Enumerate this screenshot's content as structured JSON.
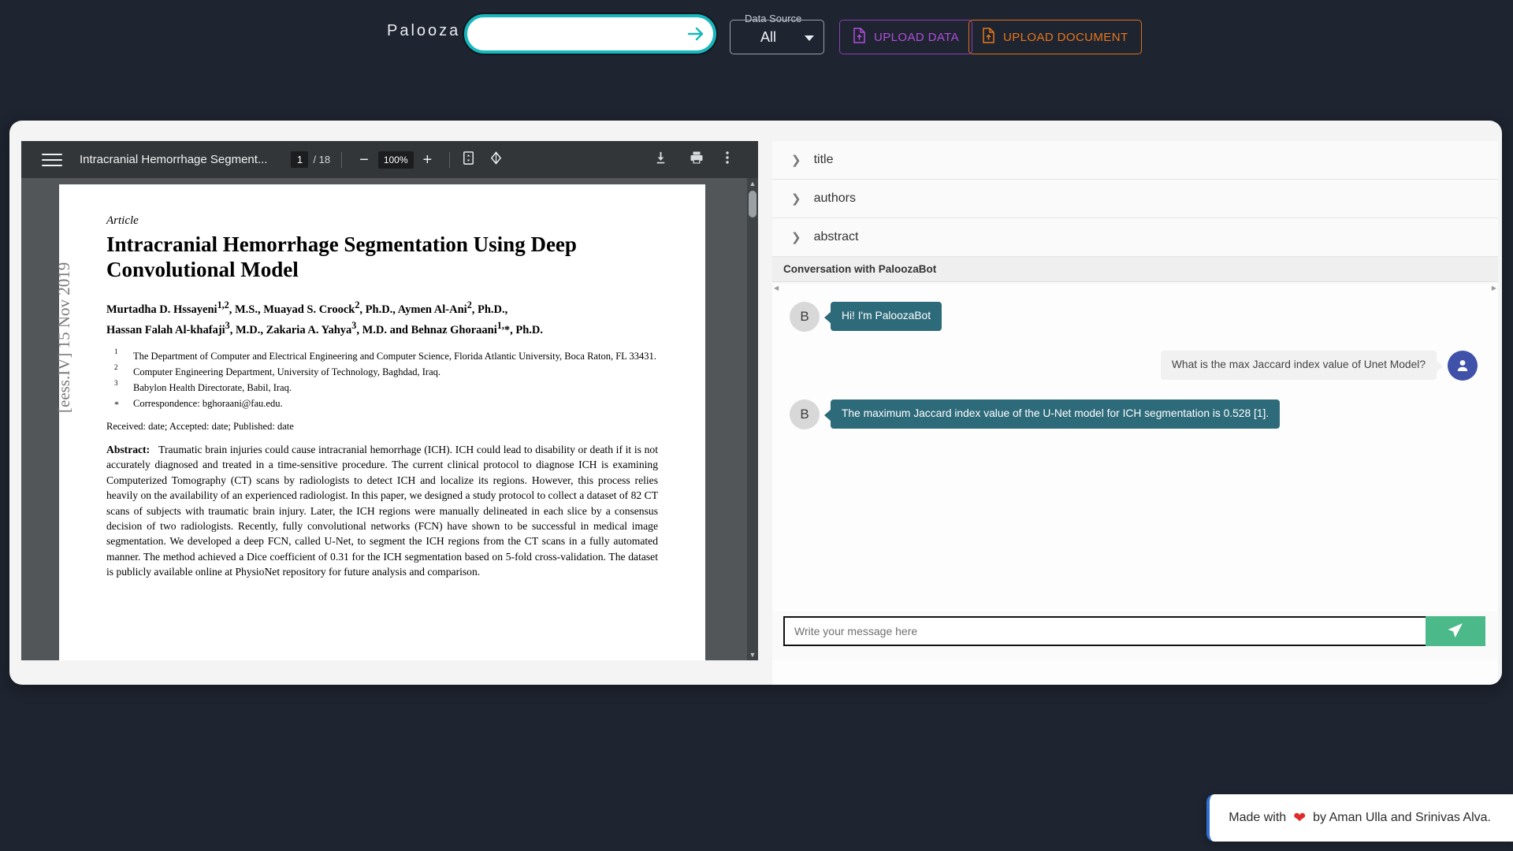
{
  "topbar": {
    "brand": "Palooza",
    "search": {
      "value": "",
      "placeholder": ""
    },
    "search_submit_icon": "arrow-right-icon",
    "data_source": {
      "legend": "Data Source",
      "selected": "All",
      "options": [
        "All"
      ]
    },
    "upload_data_button": "UPLOAD DATA",
    "upload_document_button": "UPLOAD DOCUMENT"
  },
  "pdf_viewer": {
    "menu_icon": "hamburger-menu-icon",
    "document_title": "Intracranial Hemorrhage Segment...",
    "current_page": "1",
    "page_separator": "/ 18",
    "total_pages": "18",
    "zoom_out_label": "−",
    "zoom_level": "100%",
    "zoom_in_label": "+",
    "fit_page_icon": "fit-page-icon",
    "rotate_icon": "rotate-icon",
    "download_icon": "download-icon",
    "print_icon": "print-icon",
    "more_icon": "more-vertical-icon"
  },
  "document": {
    "arxiv_stamp": "[eess.IV]  15 Nov 2019",
    "kind": "Article",
    "title": "Intracranial Hemorrhage Segmentation Using Deep Convolutional Model",
    "authors_line1": "Murtadha D. Hssayeni1,2, M.S., Muayad S. Croock2, Ph.D., Aymen Al-Ani2, Ph.D.,",
    "authors_line2": "Hassan Falah Al-khafaji3, M.D., Zakaria A. Yahya3, M.D. and Behnaz Ghoraani1,*, Ph.D.",
    "affiliations": [
      {
        "marker": "1",
        "text": "The Department of Computer and Electrical Engineering and Computer Science, Florida Atlantic University, Boca Raton, FL 33431."
      },
      {
        "marker": "2",
        "text": "Computer Engineering Department, University of Technology, Baghdad, Iraq."
      },
      {
        "marker": "3",
        "text": "Babylon Health Directorate, Babil, Iraq."
      },
      {
        "marker": "*",
        "text": "Correspondence: bghoraani@fau.edu."
      }
    ],
    "received_line": "Received: date; Accepted: date; Published: date",
    "abstract_label": "Abstract:",
    "abstract_text": "Traumatic brain injuries could cause intracranial hemorrhage (ICH). ICH could lead to disability or death if it is not accurately diagnosed and treated in a time-sensitive procedure. The current clinical protocol to diagnose ICH is examining Computerized Tomography (CT) scans by radiologists to detect ICH and localize its regions. However, this process relies heavily on the availability of an experienced radiologist. In this paper, we designed a study protocol to collect a dataset of 82 CT scans of subjects with traumatic brain injury. Later, the ICH regions were manually delineated in each slice by a consensus decision of two radiologists. Recently, fully convolutional networks (FCN) have shown to be successful in medical image segmentation. We developed a deep FCN, called U-Net, to segment the ICH regions from the CT scans in a fully automated manner. The method achieved a Dice coefficient of 0.31 for the ICH segmentation based on 5-fold cross-validation. The dataset is publicly available online at PhysioNet repository for future analysis and comparison."
  },
  "panel": {
    "accordions": [
      {
        "label": "title",
        "icon": "chevron-right-icon"
      },
      {
        "label": "authors",
        "icon": "chevron-right-icon"
      },
      {
        "label": "abstract",
        "icon": "chevron-right-icon"
      }
    ],
    "conversation_header": "Conversation with PaloozaBot",
    "messages": [
      {
        "sender": "bot",
        "avatar": "B",
        "text": "Hi! I'm PaloozaBot"
      },
      {
        "sender": "user",
        "avatar": "person-icon",
        "text": "What is the max Jaccard index value of Unet Model?"
      },
      {
        "sender": "bot",
        "avatar": "B",
        "text": "The maximum Jaccard index value of the U-Net model for ICH segmentation is 0.528 [1]."
      }
    ],
    "input": {
      "value": "",
      "placeholder": "Write your message here"
    },
    "send_icon": "send-paper-plane-icon"
  },
  "footer": {
    "prefix": "Made with",
    "heart_icon": "heart-icon",
    "suffix": "by Aman Ulla and Srinivas Alva."
  },
  "colors": {
    "page_bg": "#1e2430",
    "accent_teal": "#17b8bd",
    "upload_data": "#b24ede",
    "upload_document": "#e8761a",
    "bot_bubble": "#2e6b7a",
    "user_avatar": "#3f51a8",
    "send_button": "#4cb98b",
    "footer_accent": "#2f6fd0",
    "heart": "#e02b2b"
  }
}
